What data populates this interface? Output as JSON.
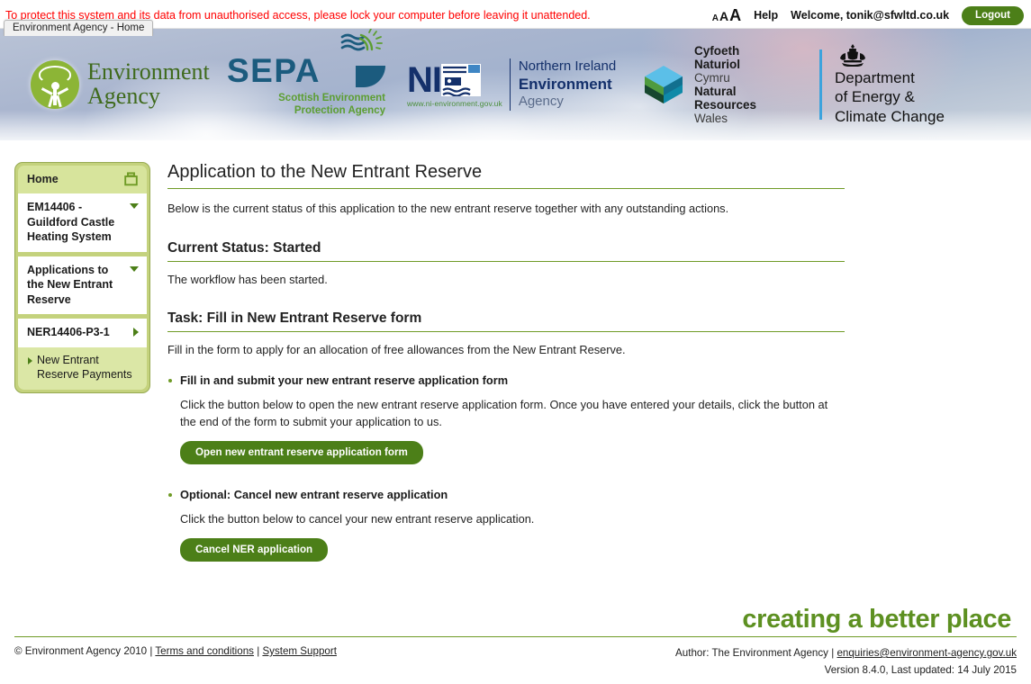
{
  "topbar": {
    "security_message": "To protect this system and its data from unauthorised access, please lock your computer before leaving it unattended.",
    "browser_tab_title": "Environment Agency - Home",
    "text_size_small": "A",
    "text_size_medium": "A",
    "text_size_large": "A",
    "help_label": "Help",
    "welcome_text": "Welcome, tonik@sfwltd.co.uk",
    "logout_label": "Logout"
  },
  "banner": {
    "ea": {
      "line1": "Environment",
      "line2": "Agency"
    },
    "sepa": {
      "word": "SEPA",
      "sub_line1": "Scottish Environment",
      "sub_line2": "Protection Agency"
    },
    "niea": {
      "word": "NI A",
      "url": "www.ni-environment.gov.uk",
      "r1": "Northern Ireland",
      "r2": "Environment",
      "r3": "Agency"
    },
    "nrw": {
      "l1": "Cyfoeth",
      "l2": "Naturiol",
      "l3": "Cymru",
      "l4": "Natural",
      "l5": "Resources",
      "l6": "Wales"
    },
    "decc": {
      "l1": "Department",
      "l2": "of Energy &",
      "l3": "Climate Change"
    }
  },
  "sidebar": {
    "home_label": "Home",
    "items": [
      {
        "label": "EM14406 - Guildford Castle Heating System",
        "caret": "down"
      },
      {
        "label": "Applications to the New Entrant Reserve",
        "caret": "down"
      },
      {
        "label": "NER14406-P3-1",
        "caret": "right"
      }
    ],
    "sub_item_label": "New Entrant Reserve Payments"
  },
  "main": {
    "page_title": "Application to the New Entrant Reserve",
    "intro": "Below is the current status of this application to the new entrant reserve together with any outstanding actions.",
    "status_heading": "Current Status: Started",
    "status_body": "The workflow has been started.",
    "task_heading": "Task: Fill in New Entrant Reserve form",
    "task_body": "Fill in the form to apply for an allocation of free allowances from the New Entrant Reserve.",
    "actions": [
      {
        "title": "Fill in and submit your new entrant reserve application form",
        "body": "Click the button below to open the new entrant reserve application form. Once you have entered your details, click the button at the end of the form to submit your application to us.",
        "button": "Open new entrant reserve application form"
      },
      {
        "title": "Optional: Cancel new entrant reserve application",
        "body": "Click the button below to cancel your new entrant reserve application.",
        "button": "Cancel NER application"
      }
    ]
  },
  "footer": {
    "tagline": "creating a better place",
    "copyright": "© Environment Agency 2010",
    "sep1": "|",
    "terms_label": "Terms and conditions",
    "sep2": "|",
    "support_label": "System Support",
    "author_prefix": "Author: The Environment Agency",
    "author_sep": "|",
    "author_email": "enquiries@environment-agency.gov.uk",
    "version": "Version 8.4.0, Last updated: 14 July 2015"
  },
  "colors": {
    "brand_green": "#4c7f18",
    "rule_green": "#6f9b26",
    "tagline_green": "#5d9021",
    "sidebar_green": "#c4d27d",
    "alert_red": "#ff0000"
  }
}
